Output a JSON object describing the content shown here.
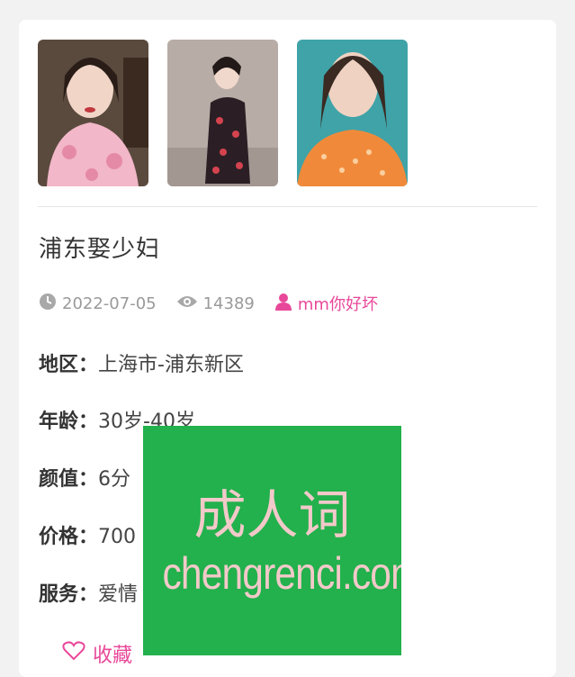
{
  "post": {
    "title": "浦东娶少妇",
    "date": "2022-07-05",
    "views": "14389",
    "author": "mm你好坏"
  },
  "fields": [
    {
      "key": "地区：",
      "value": "上海市-浦东新区"
    },
    {
      "key": "年龄：",
      "value": "30岁-40岁"
    },
    {
      "key": "颜值：",
      "value": "6分"
    },
    {
      "key": "价格：",
      "value": "700"
    },
    {
      "key": "服务：",
      "value": "爱情"
    }
  ],
  "favorite_label": "收藏",
  "watermark": {
    "line1": "成人词",
    "line2": "chengrenci.com"
  },
  "colors": {
    "accent": "#e8489a",
    "watermark_bg": "#22b14c"
  },
  "icons": [
    "clock-icon",
    "eye-icon",
    "user-icon",
    "heart-icon"
  ]
}
